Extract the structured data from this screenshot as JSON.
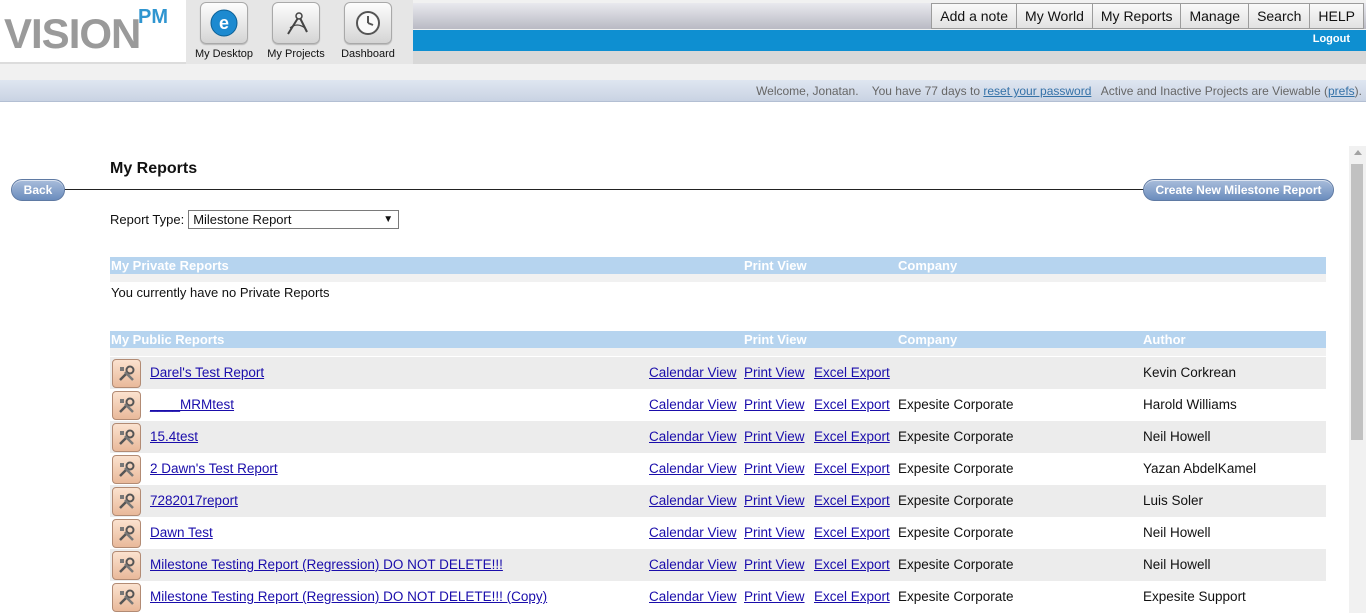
{
  "logo": {
    "vision": "VISION",
    "pm": "PM"
  },
  "nav_tiles": [
    {
      "label": "My Desktop"
    },
    {
      "label": "My Projects"
    },
    {
      "label": "Dashboard"
    }
  ],
  "top_menu": [
    "Add a note",
    "My World",
    "My Reports",
    "Manage",
    "Search",
    "HELP"
  ],
  "logout": "Logout",
  "info": {
    "welcome": "Welcome, Jonatan.",
    "days_prefix": "You have 77 days to",
    "reset_link": "reset your password",
    "viewable_prefix": "Active and Inactive Projects are Viewable (",
    "prefs_link": "prefs",
    "viewable_suffix": ")."
  },
  "page": {
    "title": "My Reports",
    "back": "Back",
    "create": "Create New Milestone Report",
    "report_type_label": "Report Type:",
    "report_type_value": "Milestone Report"
  },
  "private_section": {
    "title": "My Private Reports",
    "print_view": "Print View",
    "company": "Company",
    "empty": "You currently have no Private Reports"
  },
  "public_section": {
    "title": "My Public Reports",
    "print_view": "Print View",
    "company": "Company",
    "author": "Author"
  },
  "row_links": {
    "calendar": "Calendar View",
    "print": "Print View",
    "excel": "Excel Export"
  },
  "public_reports": [
    {
      "name": "Darel's Test Report",
      "company": "",
      "author": "Kevin Corkrean"
    },
    {
      "name": "____MRMtest",
      "company": "Expesite Corporate",
      "author": "Harold Williams"
    },
    {
      "name": "15.4test",
      "company": "Expesite Corporate",
      "author": "Neil Howell"
    },
    {
      "name": "2 Dawn's Test Report",
      "company": "Expesite Corporate",
      "author": "Yazan AbdelKamel"
    },
    {
      "name": "7282017report",
      "company": "Expesite Corporate",
      "author": "Luis Soler"
    },
    {
      "name": "Dawn Test",
      "company": "Expesite Corporate",
      "author": "Neil Howell"
    },
    {
      "name": "Milestone Testing Report (Regression) DO NOT DELETE!!!",
      "company": "Expesite Corporate",
      "author": "Neil Howell"
    },
    {
      "name": "Milestone Testing Report (Regression) DO NOT DELETE!!! (Copy)",
      "company": "Expesite Corporate",
      "author": "Expesite Support"
    }
  ],
  "colors": {
    "accent_blue": "#0e8fd1",
    "section_header": "#b6d4ef",
    "button": "#7b98c4"
  }
}
